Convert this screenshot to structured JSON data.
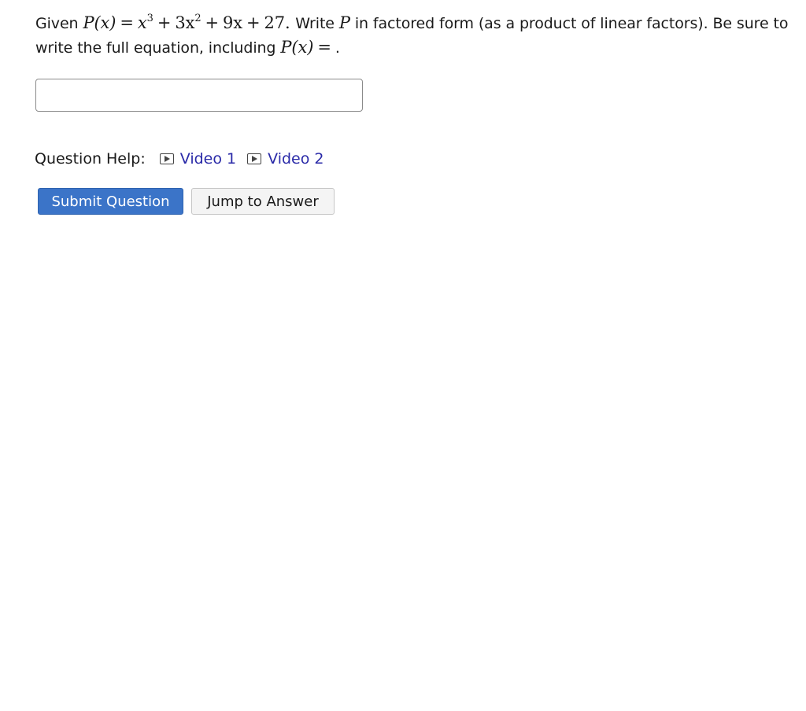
{
  "question": {
    "given": "Given",
    "fx": "P(x)",
    "eq": "=",
    "term1": "x",
    "term1_exp": "3",
    "plus1": "+",
    "term2": "3x",
    "term2_exp": "2",
    "plus2": "+",
    "term3": "9x",
    "plus3": "+",
    "term4": "27.",
    "write": "Write",
    "p": "P",
    "instruction": "in factored form (as a product of linear factors). Be sure to write the full equation, including",
    "fx2": "P(x)",
    "eq2": "=",
    "period": "."
  },
  "answer": {
    "value": "",
    "placeholder": ""
  },
  "help": {
    "label": "Question Help:",
    "videos": [
      {
        "label": "Video 1",
        "icon": "play-icon"
      },
      {
        "label": "Video 2",
        "icon": "play-icon"
      }
    ]
  },
  "buttons": {
    "submit": "Submit Question",
    "jump": "Jump to Answer"
  },
  "colors": {
    "primary": "#3b74c8",
    "link": "#2a2aa8"
  }
}
